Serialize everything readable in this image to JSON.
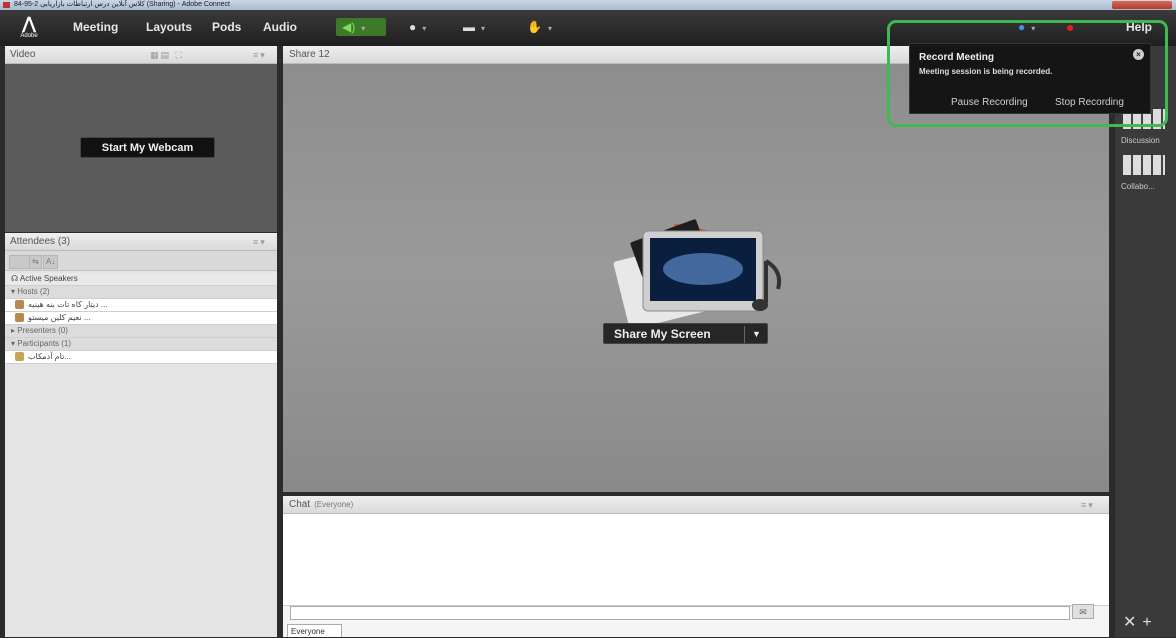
{
  "window": {
    "title": "84-95-2 کلاس آنلاین درس ارتباطات بازاریابی (Sharing) - Adobe Connect"
  },
  "menubar": {
    "logo_label": "Adobe",
    "items": [
      "Meeting",
      "Layouts",
      "Pods",
      "Audio"
    ],
    "help": "Help"
  },
  "video_pod": {
    "title": "Video",
    "webcam_button": "Start My Webcam"
  },
  "attendees_pod": {
    "title": "Attendees (3)",
    "active_speakers": "Active Speakers",
    "hosts_header": "Hosts (2)",
    "hosts": [
      "... دیتار کاه تات بنه هینیه",
      "... نعیم کلین میستو"
    ],
    "presenters_header": "Presenters (0)",
    "participants_header": "Participants (1)",
    "participants": [
      "...تام آدمکاب"
    ]
  },
  "share_pod": {
    "title": "Share 12",
    "share_button": "Share My Screen"
  },
  "chat_pod": {
    "title": "Chat",
    "subtitle": "(Everyone)",
    "tab": "Everyone"
  },
  "rail": {
    "labels": [
      "Discussion",
      "Collabo..."
    ]
  },
  "record_popup": {
    "title": "Record Meeting",
    "message": "Meeting session is being recorded.",
    "pause": "Pause Recording",
    "stop": "Stop Recording"
  },
  "colors": {
    "highlight": "#3fb950",
    "record_dot": "#e02020"
  }
}
